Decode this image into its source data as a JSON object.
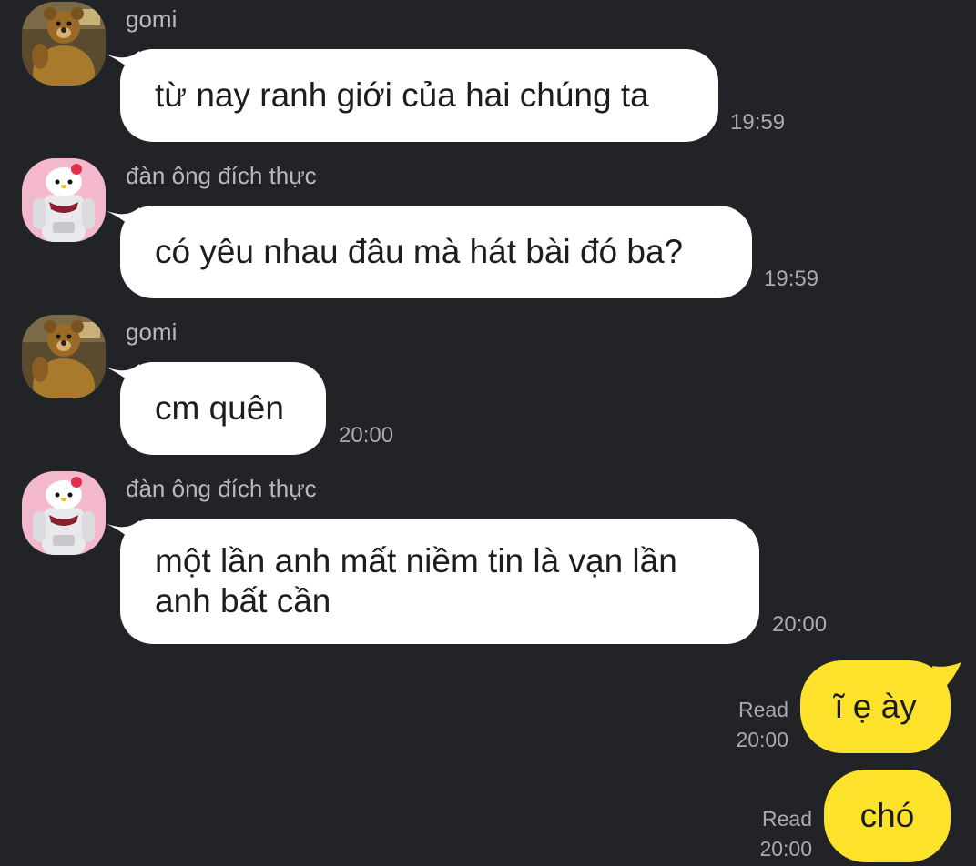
{
  "colors": {
    "background": "#222326",
    "incoming_bubble": "#ffffff",
    "outgoing_bubble": "#fde22b",
    "meta_text": "#a9aaae"
  },
  "messages": [
    {
      "sender": "gomi",
      "avatar_icon": "bear-avatar-icon",
      "text": "từ nay ranh giới của hai chúng ta",
      "time": "19:59"
    },
    {
      "sender": "đàn ông đích thực",
      "avatar_icon": "kitty-avatar-icon",
      "text": "có yêu nhau đâu mà hát bài đó ba?",
      "time": "19:59"
    },
    {
      "sender": "gomi",
      "avatar_icon": "bear-avatar-icon",
      "text": "cm quên",
      "time": "20:00"
    },
    {
      "sender": "đàn ông đích thực",
      "avatar_icon": "kitty-avatar-icon",
      "text": "một lần anh mất niềm tin là vạn lần\nanh bất cần",
      "time": "20:00"
    }
  ],
  "outgoing": [
    {
      "text": "ĩ ẹ ày",
      "status": "Read",
      "time": "20:00"
    },
    {
      "text": "chó",
      "status": "Read",
      "time": "20:00"
    }
  ]
}
